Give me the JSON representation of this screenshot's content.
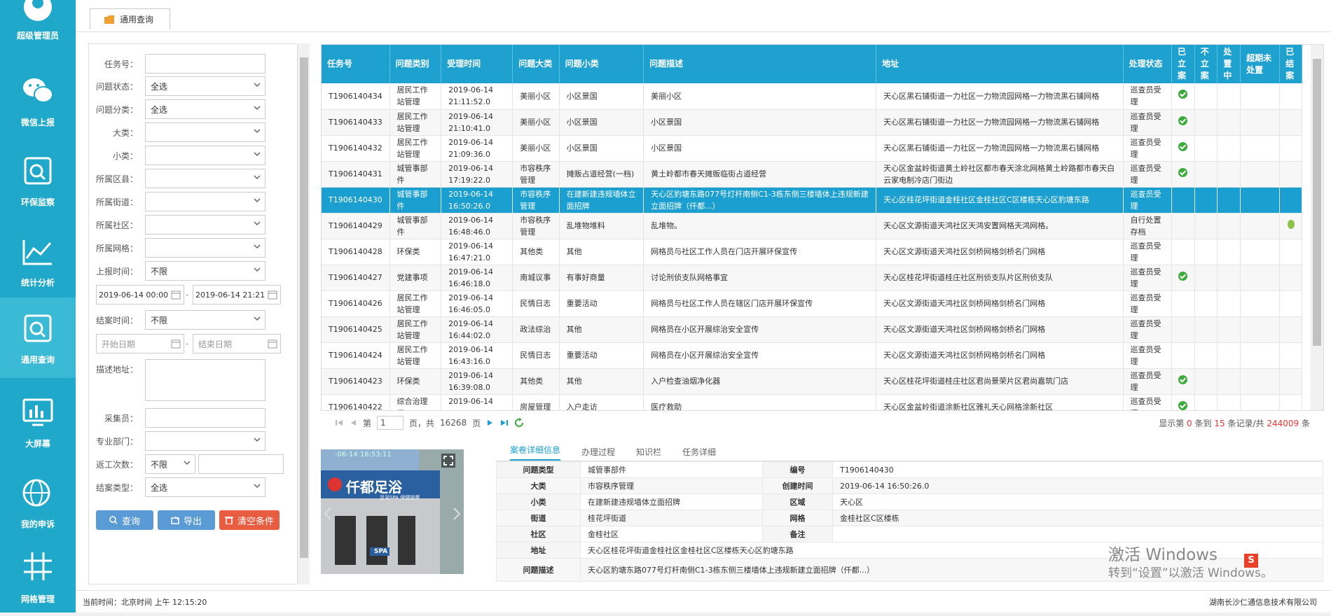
{
  "sidebar": {
    "items": [
      {
        "label": "超级管理员",
        "icon": "user-icon"
      },
      {
        "label": "微信上报",
        "icon": "wechat-icon"
      },
      {
        "label": "环保监察",
        "icon": "search-icon"
      },
      {
        "label": "统计分析",
        "icon": "chart-icon"
      },
      {
        "label": "通用查询",
        "icon": "search-icon"
      },
      {
        "label": "大屏幕",
        "icon": "screen-icon"
      },
      {
        "label": "我的申诉",
        "icon": "globe-icon"
      },
      {
        "label": "网格管理",
        "icon": "grid-icon"
      }
    ]
  },
  "tab": {
    "label": "通用查询"
  },
  "filters": {
    "task_label": "任务号：",
    "status_label": "问题状态：",
    "status_value": "全选",
    "category_label": "问题分类：",
    "category_value": "全选",
    "major_label": "大类：",
    "minor_label": "小类：",
    "district_label": "所属区县：",
    "street_label": "所属街道：",
    "community_label": "所属社区：",
    "grid_label": "所属网格：",
    "report_time_label": "上报时间：",
    "report_time_value": "不限",
    "date_from": "2019-06-14 00:00",
    "date_to": "2019-06-14 21:21",
    "close_time_label": "结案时间：",
    "close_time_value": "不限",
    "start_ph": "开始日期",
    "end_ph": "结束日期",
    "desc_label": "描述地址：",
    "collector_label": "采集员：",
    "dept_label": "专业部门：",
    "rework_label": "返工次数：",
    "rework_value": "不限",
    "close_type_label": "结案类型：",
    "close_type_value": "全选",
    "query_btn": "查询",
    "export_btn": "导出",
    "clear_btn": "清空条件"
  },
  "table": {
    "headers": [
      "任务号",
      "问题类别",
      "受理时间",
      "问题大类",
      "问题小类",
      "问题描述",
      "地址",
      "处理状态",
      "已立案",
      "不立案",
      "处置中",
      "超期未处置",
      "已结案"
    ],
    "rows": [
      {
        "id": "T1906140434",
        "cat": "居民工作站管理",
        "time": "2019-06-14 21:11:52.0",
        "major": "美丽小区",
        "minor": "小区景国",
        "desc": "美丽小区",
        "addr": "天心区黑石铺街道一力社区一力物流园网格一力物流黑石铺网格",
        "status": "巡查员受理",
        "filed": true,
        "closed": false
      },
      {
        "id": "T1906140433",
        "cat": "居民工作站管理",
        "time": "2019-06-14 21:10:41.0",
        "major": "美丽小区",
        "minor": "小区景国",
        "desc": "小区景国",
        "addr": "天心区黑石铺街道一力社区一力物流园网格一力物流黑石铺网格",
        "status": "巡查员受理",
        "filed": true,
        "closed": false
      },
      {
        "id": "T1906140432",
        "cat": "居民工作站管理",
        "time": "2019-06-14 21:09:36.0",
        "major": "美丽小区",
        "minor": "小区景国",
        "desc": "小区景国",
        "addr": "天心区黑石铺街道一力社区一力物流园网格一力物流黑石铺网格",
        "status": "巡查员受理",
        "filed": true,
        "closed": false
      },
      {
        "id": "T1906140431",
        "cat": "城管事部件",
        "time": "2019-06-14 17:19:22.0",
        "major": "市容秩序管理",
        "minor": "摊贩占道经营(一档)",
        "desc": "黄土岭都市春天摊贩临街占道经营",
        "addr": "天心区金盆岭街道黄土岭社区都市春天涂北网格黄土岭路都市春天白云家电制冷店门街边",
        "status": "巡查员受理",
        "filed": true,
        "closed": false
      },
      {
        "id": "T1906140430",
        "cat": "城管事部件",
        "time": "2019-06-14 16:50:26.0",
        "major": "市容秩序管理",
        "minor": "在建新建违规墙体立面招牌",
        "desc": "天心区豹塘东路077号灯杆南侧C1-3栋东侧三楼墙体上违规新建立面招牌（仟都...）",
        "addr": "天心区桂花坪街道金桂社区金桂社区C区楼栋天心区豹塘东路",
        "status": "巡查员受理",
        "filed": false,
        "closed": false,
        "selected": true
      },
      {
        "id": "T1906140429",
        "cat": "城管事部件",
        "time": "2019-06-14 16:48:46.0",
        "major": "市容秩序管理",
        "minor": "乱堆物堆料",
        "desc": "乱堆物。",
        "addr": "天心区文源街道天鸿社区天鸿安置网格天鸿网格。",
        "status": "自行处置存档",
        "filed": false,
        "closed": true
      },
      {
        "id": "T1906140428",
        "cat": "环保类",
        "time": "2019-06-14 16:47:21.0",
        "major": "其他类",
        "minor": "其他",
        "desc": "网格员与社区工作人员在门店开展环保宣传",
        "addr": "天心区文源街道天鸿社区剑桥网格剑桥名门网格",
        "status": "巡查员受理",
        "filed": false,
        "closed": false
      },
      {
        "id": "T1906140427",
        "cat": "党建事项",
        "time": "2019-06-14 16:46:18.0",
        "major": "南城议事",
        "minor": "有事好商量",
        "desc": "讨论刑侦支队网格事宜",
        "addr": "天心区桂花坪街道桂庄社区刑侦支队片区刑侦支队",
        "status": "巡查员受理",
        "filed": true,
        "closed": false
      },
      {
        "id": "T1906140426",
        "cat": "居民工作站管理",
        "time": "2019-06-14 16:46:05.0",
        "major": "民情日志",
        "minor": "重要活动",
        "desc": "网格员与社区工作人员在辖区门店开展环保宣传",
        "addr": "天心区文源街道天鸿社区剑桥网格剑桥名门网格",
        "status": "巡查员受理",
        "filed": false,
        "closed": false
      },
      {
        "id": "T1906140425",
        "cat": "居民工作站管理",
        "time": "2019-06-14 16:44:02.0",
        "major": "政法综治",
        "minor": "其他",
        "desc": "网格员在小区开展综治安全宣传",
        "addr": "天心区文源街道天鸿社区剑桥网格剑桥名门网格",
        "status": "巡查员受理",
        "filed": false,
        "closed": false
      },
      {
        "id": "T1906140424",
        "cat": "居民工作站管理",
        "time": "2019-06-14 16:43:16.0",
        "major": "民情日志",
        "minor": "重要活动",
        "desc": "网格员在小区开展综治安全宣传",
        "addr": "天心区文源街道天鸿社区剑桥网格剑桥名门网格",
        "status": "巡查员受理",
        "filed": false,
        "closed": false
      },
      {
        "id": "T1906140423",
        "cat": "环保类",
        "time": "2019-06-14 16:39:08.0",
        "major": "其他类",
        "minor": "其他",
        "desc": "入户检查油烟净化器",
        "addr": "天心区桂花坪街道桂庄社区君尚景荣片区君尚嘉筑门店",
        "status": "巡查员受理",
        "filed": true,
        "closed": false
      },
      {
        "id": "T1906140422",
        "cat": "综合治理类",
        "time": "2019-06-14 16:37:50.0",
        "major": "房屋管理",
        "minor": "入户走访",
        "desc": "医疗救助",
        "addr": "天心区金盆岭街道涂新社区雅礼天心网格涂新社区",
        "status": "巡查员受理",
        "filed": true,
        "closed": false
      }
    ]
  },
  "pager": {
    "page_label": "第",
    "page_value": "1",
    "total_label": "页，共",
    "total_pages": "16268",
    "pages_suffix": "页",
    "display_prefix": "显示第",
    "from": "0",
    "to_label": "条到",
    "to": "15",
    "records_label": "条记录/共",
    "total": "244009",
    "suffix": "条"
  },
  "photo": {
    "timestamp": "-06-14 16:53:11",
    "sign_text": "仟都足浴",
    "sub_text": "足浴SPA 保健按摩",
    "spa_text": "SPA"
  },
  "details": {
    "tabs": [
      "案卷详细信息",
      "办理过程",
      "知识栏",
      "任务详细"
    ],
    "rows": [
      {
        "k1": "问题类型",
        "v1": "城管事部件",
        "k2": "编号",
        "v2": "T1906140430"
      },
      {
        "k1": "大类",
        "v1": "市容秩序管理",
        "k2": "创建时间",
        "v2": "2019-06-14 16:50:26.0"
      },
      {
        "k1": "小类",
        "v1": "在建新建违规墙体立面招牌",
        "k2": "区域",
        "v2": "天心区"
      },
      {
        "k1": "街道",
        "v1": "桂花坪街道",
        "k2": "网格",
        "v2": "金桂社区C区楼栋"
      },
      {
        "k1": "社区",
        "v1": "金桂社区",
        "k2": "备注",
        "v2": ""
      }
    ],
    "address_label": "地址",
    "address_value": "天心区桂花坪街道金桂社区金桂社区C区楼栋天心区豹塘东路",
    "desc_label": "问题描述",
    "desc_value": "天心区豹塘东路077号灯杆南侧C1-3栋东侧三楼墙体上违规新建立面招牌（仟都...）"
  },
  "status_bar": {
    "time": "当前时间：北京时间 上午 12:15:20",
    "company": "湖南长沙仁通信息技术有限公司"
  },
  "watermark": {
    "line1": "激活 Windows",
    "line2": "转到“设置”以激活 Windows。"
  }
}
